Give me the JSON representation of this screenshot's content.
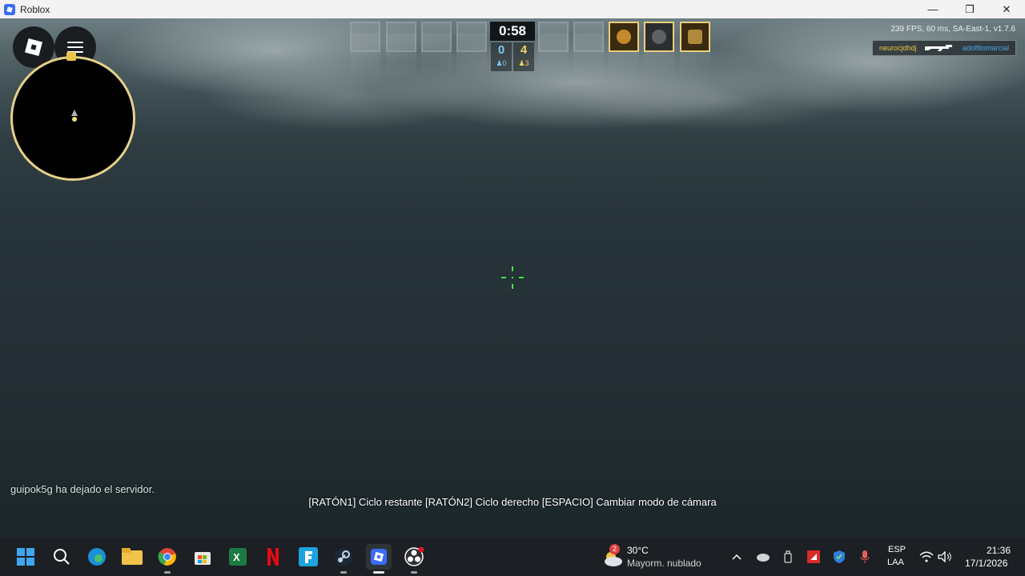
{
  "window": {
    "title": "Roblox",
    "minimize": "—",
    "restore": "❐",
    "close": "✕"
  },
  "hud": {
    "timer": "0:58",
    "team_left": {
      "score": "0",
      "alive": "♟0"
    },
    "team_right": {
      "score": "4",
      "alive": "♟3"
    },
    "perf": "239 FPS, 60 ms, SA-East-1, v1.7.6",
    "killfeed": {
      "killer": "neurocjdhdj",
      "victim": "adolfitomarcial",
      "weapon_icon": "rifle-icon"
    },
    "colors": {
      "killer": "#e8c640",
      "victim": "#4ea3e8",
      "crosshair": "#44e844",
      "minimap_border": "#e6d08a"
    }
  },
  "chat": {
    "message": "guipok5g ha dejado el servidor."
  },
  "controls_hint": "[RATÓN1] Ciclo restante  [RATÓN2] Ciclo derecho  [ESPACIO] Cambiar modo de cámara",
  "taskbar": {
    "apps": [
      "start-icon",
      "search-icon",
      "edge-icon",
      "file-explorer-icon",
      "chrome-icon",
      "store-icon",
      "excel-icon",
      "netflix-icon",
      "fortnite-icon",
      "steam-icon",
      "roblox-icon",
      "obs-icon"
    ],
    "weather": {
      "badge": "2",
      "temp": "30°C",
      "desc": "Mayorm. nublado"
    },
    "lang": {
      "line1": "ESP",
      "line2": "LAA"
    },
    "clock": {
      "time": "21:36",
      "date": "17/1/2026"
    }
  }
}
